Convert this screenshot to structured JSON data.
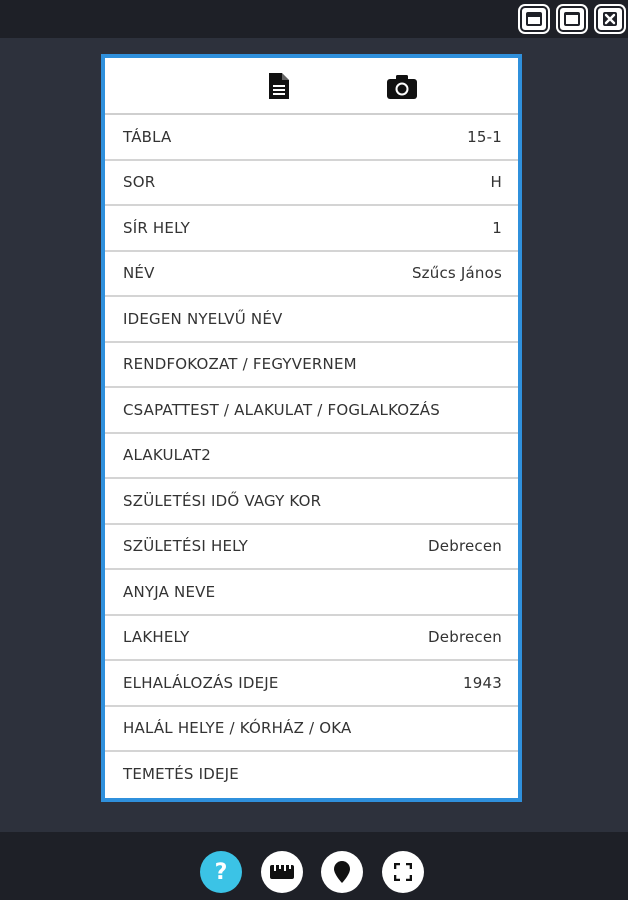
{
  "window_controls": {
    "minimize_icon": "minimize-icon",
    "maximize_icon": "maximize-icon",
    "close_icon": "close-icon"
  },
  "header": {
    "document_icon": "document-icon",
    "camera_icon": "camera-icon"
  },
  "rows": [
    {
      "label": "TÁBLA",
      "value": "15-1"
    },
    {
      "label": "SOR",
      "value": "H"
    },
    {
      "label": "SÍR HELY",
      "value": "1"
    },
    {
      "label": "NÉV",
      "value": "Szűcs János"
    },
    {
      "label": "IDEGEN NYELVŰ NÉV",
      "value": ""
    },
    {
      "label": "RENDFOKOZAT / FEGYVERNEM",
      "value": ""
    },
    {
      "label": "CSAPATTEST / ALAKULAT / FOGLALKOZÁS",
      "value": ""
    },
    {
      "label": "ALAKULAT2",
      "value": ""
    },
    {
      "label": "SZÜLETÉSI IDŐ VAGY KOR",
      "value": ""
    },
    {
      "label": "SZÜLETÉSI HELY",
      "value": "Debrecen"
    },
    {
      "label": "ANYJA NEVE",
      "value": ""
    },
    {
      "label": "LAKHELY",
      "value": "Debrecen"
    },
    {
      "label": "ELHALÁLOZÁS IDEJE",
      "value": "1943"
    },
    {
      "label": "HALÁL HELYE / KÓRHÁZ / OKA",
      "value": ""
    },
    {
      "label": "TEMETÉS IDEJE",
      "value": ""
    }
  ],
  "toolbar": {
    "help_label": "?",
    "help_icon": "help-icon",
    "ruler_icon": "ruler-icon",
    "location_icon": "location-pin-icon",
    "fullscreen_icon": "fullscreen-icon"
  },
  "colors": {
    "background": "#2d313c",
    "bar": "#1e2027",
    "panel_border": "#2f90dc",
    "help_button": "#3bc3e6"
  }
}
